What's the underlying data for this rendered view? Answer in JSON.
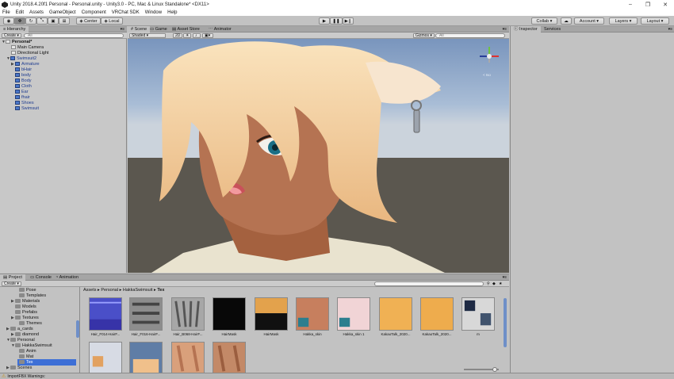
{
  "window": {
    "title": "Unity 2018.4.20f1 Personal - Personal.unity - Unity3.0 - PC, Mac & Linux Standalone* <DX11>"
  },
  "menu": [
    "File",
    "Edit",
    "Assets",
    "GameObject",
    "Component",
    "VRChat SDK",
    "Window",
    "Help"
  ],
  "toolbar": {
    "center_label": "Center",
    "local_label": "Local",
    "collab_label": "Collab ▾",
    "account_label": "Account",
    "layers_label": "Layers",
    "layout_label": "Layout"
  },
  "hierarchy": {
    "tab": "Hierarchy",
    "create_label": "Create ▾",
    "search_placeholder": "All",
    "scene_name": "Personal*",
    "items": [
      "Main Camera",
      "Directional Light",
      "Swimsuit2",
      "Armature",
      "bHair",
      "body",
      "Body",
      "Cloth",
      "Ear",
      "fhair",
      "Shoes",
      "Swimsuit"
    ]
  },
  "scene": {
    "tabs": [
      "Scene",
      "Game",
      "Asset Store",
      "Animator"
    ],
    "shading": "Shaded",
    "mode_2d": "2D",
    "gizmos_label": "Gizmos ▾",
    "search_placeholder": "All",
    "gizmo_label": "< Iso"
  },
  "inspector": {
    "tabs": [
      "Inspector",
      "Services"
    ]
  },
  "project": {
    "tabs": [
      "Project",
      "Console",
      "Animation"
    ],
    "create_label": "Create ▾",
    "breadcrumb": [
      "Assets",
      "Personal",
      "HakkaSwimsuit",
      "Tex"
    ],
    "folders": [
      "Pose",
      "Templates",
      "Materials",
      "Models",
      "Prefabs",
      "Textures",
      "Themes",
      "a_cards",
      "diamond",
      "Personal",
      "HakkaSwimsuit",
      "Anim",
      "Mat",
      "Tex",
      "Scenes"
    ],
    "assets": [
      "Hair_F014-HairF...",
      "Hair_F016-HairF...",
      "Hair_B068-HairF...",
      "HairMask",
      "HairMask",
      "Hakka_skin",
      "Hakka_skin 1",
      "KakaoTalk_2020...",
      "KakaoTalk_2020...",
      "m"
    ]
  },
  "status": {
    "message": "ImportFBX Warnings:"
  },
  "colors": {
    "sky": "#86a3ca",
    "ground": "#5b574f",
    "hair": "#f3cf9d",
    "skin": "#b06f4e",
    "selection": "#3d6fd6"
  }
}
